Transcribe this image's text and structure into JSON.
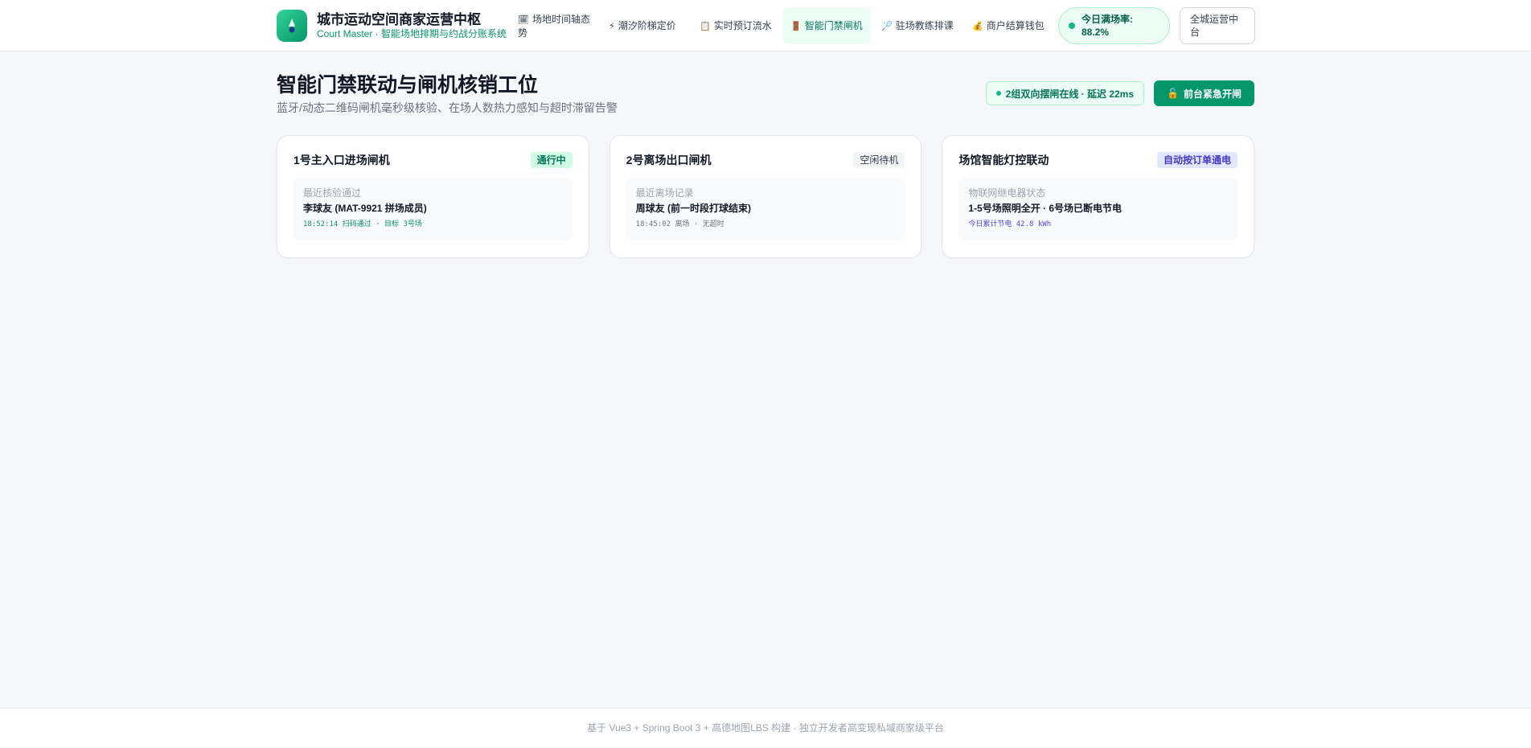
{
  "brand": {
    "title": "城市运动空间商家运营中枢",
    "subtitle": "Court Master · 智能场地排期与约战分账系统",
    "logo_icon": "badminton-shuttle-icon"
  },
  "nav": {
    "items": [
      {
        "icon": "🗓",
        "label": "场地时间轴态势"
      },
      {
        "icon": "⚡",
        "label": "潮汐阶梯定价"
      },
      {
        "icon": "📋",
        "label": "实时预订流水"
      },
      {
        "icon": "🚪",
        "label": "智能门禁闸机"
      },
      {
        "icon": "🏸",
        "label": "驻场教练排课"
      },
      {
        "icon": "💰",
        "label": "商户结算钱包"
      }
    ],
    "active_index": 3
  },
  "status": {
    "ratio": "今日满场率: 88.2%",
    "city_button": "全城运营中台"
  },
  "page": {
    "title": "智能门禁联动与闸机核销工位",
    "description": "蓝牙/动态二维码闸机毫秒级核验、在场人数热力感知与超时滞留告警",
    "online_badge": "2组双向摆闸在线 · 延迟 22ms",
    "emergency_button": "前台紧急开闸",
    "emergency_icon": "🔓"
  },
  "cards": [
    {
      "title": "1号主入口进场闸机",
      "tag": "通行中",
      "label": "最近核验通过",
      "main": "李球友 (MAT-9921 拼场成员)",
      "meta": "18:52:14 扫码通过 · 目标 3号场"
    },
    {
      "title": "2号离场出口闸机",
      "tag": "空闲待机",
      "label": "最近离场记录",
      "main": "周球友 (前一时段打球结束)",
      "meta": "18:45:02 离场 · 无超时"
    },
    {
      "title": "场馆智能灯控联动",
      "tag": "自动按订单通电",
      "label": "物联网继电器状态",
      "main": "1-5号场照明全开 · 6号场已断电节电",
      "meta": "今日累计节电 42.8 kWh"
    }
  ],
  "footer": "基于 Vue3 + Spring Boot 3 + 高德地图LBS 构建 · 独立开发者高变现私域商家级平台",
  "colors": {
    "accent": "#059669",
    "background": "#f6f7fb",
    "indigo": "#4338ca"
  }
}
